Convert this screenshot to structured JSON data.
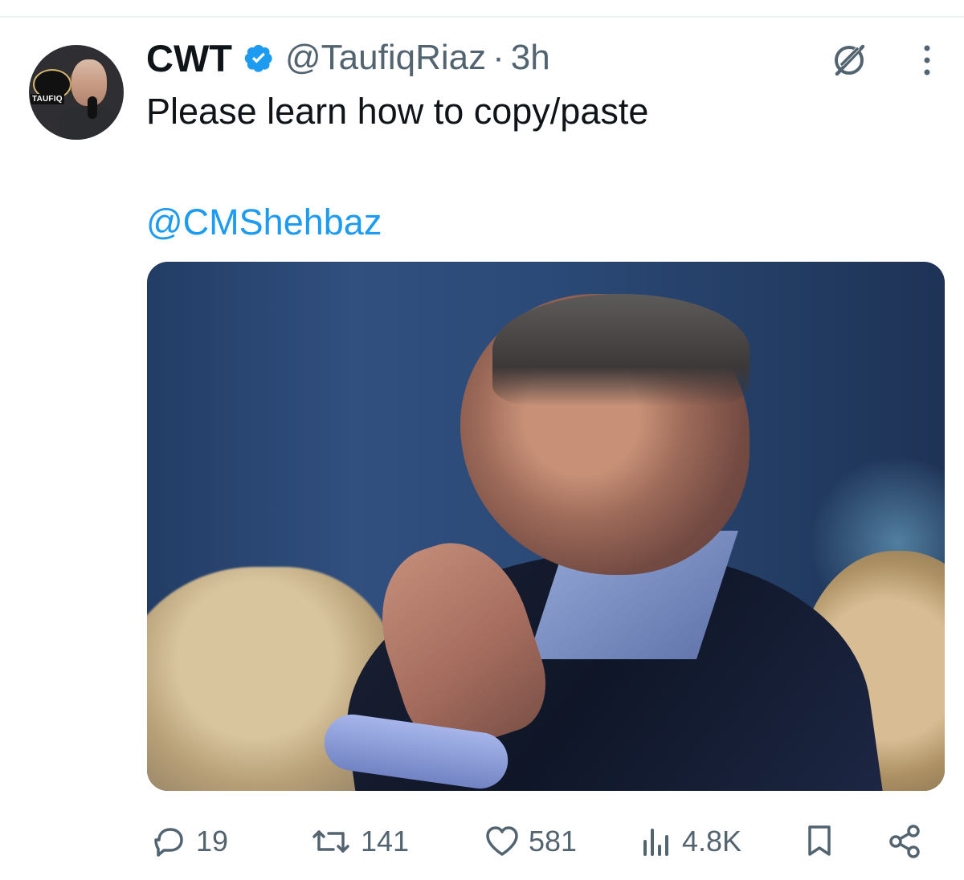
{
  "tweet": {
    "author": {
      "display_name": "CWT",
      "handle": "@TaufiqRiaz",
      "separator": "·",
      "time": "3h",
      "avatar_text": "TAUFIQ"
    },
    "text": "Please learn how to copy/paste",
    "mention": "@CMShehbaz",
    "actions": {
      "replies": "19",
      "reposts": "141",
      "likes": "581",
      "views": "4.8K"
    },
    "icons": {
      "verified": "verified-badge-icon",
      "grok": "grok-icon",
      "more": "more-icon",
      "reply": "reply-icon",
      "repost": "repost-icon",
      "like": "heart-icon",
      "views": "views-icon",
      "bookmark": "bookmark-icon",
      "share": "share-icon"
    },
    "colors": {
      "text": "#0f1419",
      "secondary": "#536471",
      "link": "#1d9bf0",
      "verified": "#1d9bf0"
    }
  }
}
